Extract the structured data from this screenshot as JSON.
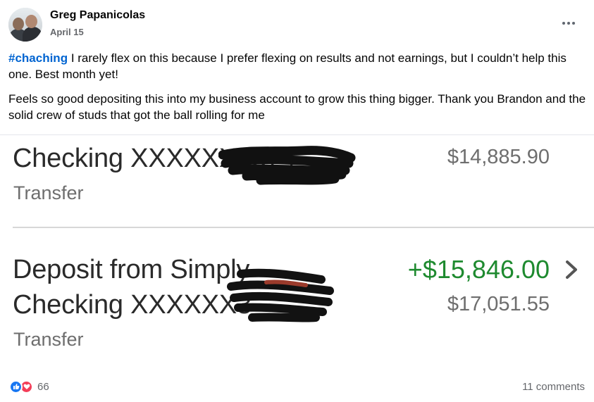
{
  "post": {
    "author": "Greg Papanicolas",
    "date": "April 15",
    "hashtag": "#chaching",
    "text_line1_rest": " I rarely flex on this because I prefer flexing on results and not earnings, but I couldn’t help this one. Best month yet!",
    "text_paragraph2": "Feels so good depositing this into my business account to grow this thing bigger. Thank you Brandon and the solid crew of studs that got the ball rolling for me"
  },
  "photo": {
    "row1": {
      "title": "Checking XXXXXX3374",
      "subtitle": "Transfer",
      "balance": "$14,885.90"
    },
    "row2": {
      "title_line1": "Deposit from Simply",
      "title_line2": "Checking XXXXXX3",
      "subtitle": "Transfer",
      "amount": "+$15,846.00",
      "balance": "$17,051.55"
    }
  },
  "footer": {
    "reaction_count": "66",
    "comments": "11 comments"
  },
  "icons": {
    "more": "more-options-icon",
    "like": "like-reaction-icon",
    "love": "love-reaction-icon",
    "chevron": "chevron-right-icon"
  },
  "colors": {
    "hashtag": "#0064d1",
    "deposit_green": "#1e8a2f",
    "like_blue": "#1877f2",
    "love_red": "#f33e58"
  }
}
